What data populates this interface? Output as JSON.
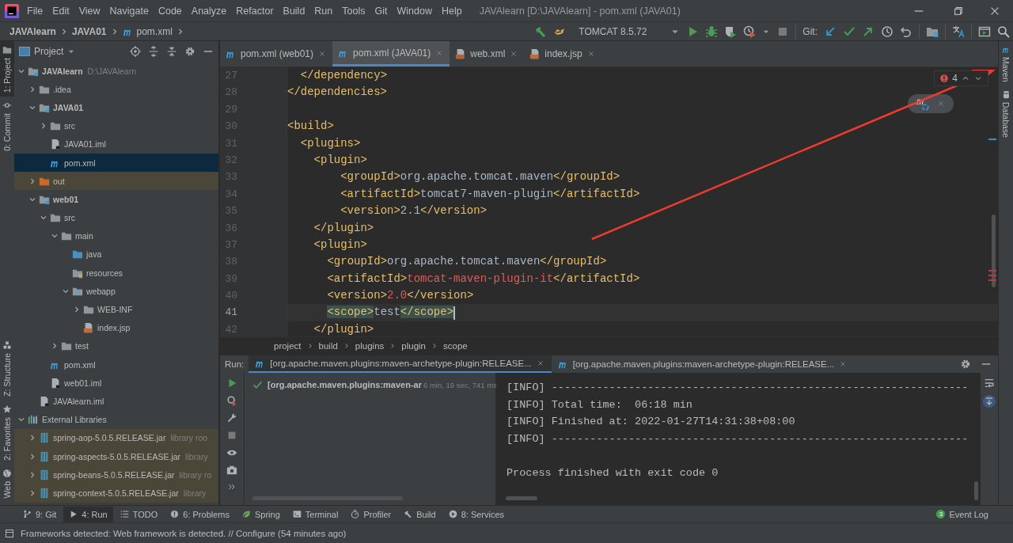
{
  "window": {
    "title": "JAVAlearn [D:\\JAVAlearn] - pom.xml (JAVA01)"
  },
  "menu": [
    "File",
    "Edit",
    "View",
    "Navigate",
    "Code",
    "Analyze",
    "Refactor",
    "Build",
    "Run",
    "Tools",
    "Git",
    "Window",
    "Help"
  ],
  "breadcrumb": [
    {
      "label": "JAVAlearn",
      "kind": "project"
    },
    {
      "label": "JAVA01",
      "kind": "project"
    },
    {
      "label": "pom.xml",
      "kind": "maven"
    }
  ],
  "toolbar": {
    "run_config": "TOMCAT 8.5.72",
    "vcs_label": "Git:"
  },
  "left_strip_top": [
    {
      "label": "1: Project",
      "kind": "project",
      "selected": true
    },
    {
      "label": "0: Commit",
      "kind": "commit",
      "selected": false
    }
  ],
  "left_strip_bottom": [
    {
      "label": "Z: Structure",
      "kind": "structure",
      "selected": false
    },
    {
      "label": "2: Favorites",
      "kind": "favorites",
      "selected": false
    },
    {
      "label": "Web",
      "kind": "web",
      "selected": false
    }
  ],
  "right_strip": [
    {
      "label": "Maven",
      "kind": "maven"
    },
    {
      "label": "Database",
      "kind": "database"
    }
  ],
  "project_panel": {
    "title": "Project",
    "tree": [
      {
        "label": "JAVAlearn",
        "hint": "D:\\JAVAlearn",
        "kind": "module",
        "expanded": true,
        "selected": false,
        "highlighted": false,
        "children": [
          {
            "label": ".idea",
            "kind": "folder",
            "expanded": false,
            "selected": false,
            "highlighted": false
          },
          {
            "label": "JAVA01",
            "kind": "module",
            "expanded": true,
            "selected": false,
            "highlighted": false,
            "children": [
              {
                "label": "src",
                "kind": "folder",
                "expanded": false,
                "selected": false,
                "highlighted": false
              },
              {
                "label": "JAVA01.iml",
                "kind": "iml",
                "selected": false,
                "highlighted": false
              },
              {
                "label": "pom.xml",
                "kind": "maven",
                "selected": true,
                "highlighted": false
              }
            ]
          },
          {
            "label": "out",
            "kind": "excluded",
            "expanded": false,
            "selected": false,
            "highlighted": true
          },
          {
            "label": "web01",
            "kind": "module",
            "expanded": true,
            "selected": false,
            "highlighted": false,
            "children": [
              {
                "label": "src",
                "kind": "folder",
                "expanded": true,
                "selected": false,
                "highlighted": false,
                "children": [
                  {
                    "label": "main",
                    "kind": "folder",
                    "expanded": true,
                    "selected": false,
                    "highlighted": false,
                    "children": [
                      {
                        "label": "java",
                        "kind": "source",
                        "selected": false,
                        "highlighted": false
                      },
                      {
                        "label": "resources",
                        "kind": "resources",
                        "selected": false,
                        "highlighted": false
                      },
                      {
                        "label": "webapp",
                        "kind": "web",
                        "expanded": true,
                        "selected": false,
                        "highlighted": false,
                        "children": [
                          {
                            "label": "WEB-INF",
                            "kind": "folder",
                            "expanded": false,
                            "selected": false,
                            "highlighted": false
                          },
                          {
                            "label": "index.jsp",
                            "kind": "jsp",
                            "selected": false,
                            "highlighted": false
                          }
                        ]
                      }
                    ]
                  },
                  {
                    "label": "test",
                    "kind": "folder",
                    "expanded": false,
                    "selected": false,
                    "highlighted": false
                  }
                ]
              },
              {
                "label": "pom.xml",
                "kind": "maven",
                "selected": false,
                "highlighted": false
              },
              {
                "label": "web01.iml",
                "kind": "iml",
                "selected": false,
                "highlighted": false
              }
            ]
          },
          {
            "label": "JAVAlearn.iml",
            "kind": "iml",
            "selected": false,
            "highlighted": false
          }
        ]
      },
      {
        "label": "External Libraries",
        "kind": "libraries",
        "expanded": true,
        "selected": false,
        "highlighted": false,
        "children": [
          {
            "label": "spring-aop-5.0.5.RELEASE.jar",
            "hint": "library roo",
            "kind": "jar",
            "expanded": false,
            "selected": false,
            "highlighted": true
          },
          {
            "label": "spring-aspects-5.0.5.RELEASE.jar",
            "hint": "library",
            "kind": "jar",
            "expanded": false,
            "selected": false,
            "highlighted": true
          },
          {
            "label": "spring-beans-5.0.5.RELEASE.jar",
            "hint": "library ro",
            "kind": "jar",
            "expanded": false,
            "selected": false,
            "highlighted": true
          },
          {
            "label": "spring-context-5.0.5.RELEASE.jar",
            "hint": "library",
            "kind": "jar",
            "expanded": false,
            "selected": false,
            "highlighted": true
          }
        ]
      }
    ]
  },
  "editor": {
    "tabs": [
      {
        "label": "pom.xml (web01)",
        "kind": "maven",
        "selected": false
      },
      {
        "label": "pom.xml (JAVA01)",
        "kind": "maven",
        "selected": true
      },
      {
        "label": "web.xml",
        "kind": "xml",
        "selected": false
      },
      {
        "label": "index.jsp",
        "kind": "jsp",
        "selected": false
      }
    ],
    "problems": "4",
    "lines": [
      {
        "number": "27",
        "current": false,
        "tokens": [
          {
            "text": "  </dependency>",
            "kind": "tag"
          }
        ]
      },
      {
        "number": "28",
        "current": false,
        "tokens": [
          {
            "text": "</dependencies>",
            "kind": "tag"
          }
        ]
      },
      {
        "number": "29",
        "current": false
      },
      {
        "number": "30",
        "current": false,
        "tokens": [
          {
            "text": "<build>",
            "kind": "tag"
          }
        ]
      },
      {
        "number": "31",
        "current": false,
        "tokens": [
          {
            "text": "  <plugins>",
            "kind": "tag"
          }
        ]
      },
      {
        "number": "32",
        "current": false,
        "tokens": [
          {
            "text": "    <plugin>",
            "kind": "tag"
          }
        ]
      },
      {
        "number": "33",
        "current": false,
        "tokens": [
          {
            "text": "        <groupId>",
            "kind": "tag"
          },
          {
            "text": "org.apache.tomcat.maven",
            "kind": "text"
          },
          {
            "text": "</groupId>",
            "kind": "tag"
          }
        ]
      },
      {
        "number": "34",
        "current": false,
        "tokens": [
          {
            "text": "        <artifactId>",
            "kind": "tag"
          },
          {
            "text": "tomcat7-maven-plugin",
            "kind": "text"
          },
          {
            "text": "</artifactId>",
            "kind": "tag"
          }
        ]
      },
      {
        "number": "35",
        "current": false,
        "tokens": [
          {
            "text": "        <version>",
            "kind": "tag"
          },
          {
            "text": "2.1",
            "kind": "text"
          },
          {
            "text": "</version>",
            "kind": "tag"
          }
        ]
      },
      {
        "number": "36",
        "current": false,
        "tokens": [
          {
            "text": "    </plugin>",
            "kind": "tag"
          }
        ]
      },
      {
        "number": "37",
        "current": false,
        "tokens": [
          {
            "text": "    <plugin>",
            "kind": "tag"
          }
        ]
      },
      {
        "number": "38",
        "current": false,
        "tokens": [
          {
            "text": "      <groupId>",
            "kind": "tag"
          },
          {
            "text": "org.apache.tomcat.maven",
            "kind": "text"
          },
          {
            "text": "</groupId>",
            "kind": "tag"
          }
        ]
      },
      {
        "number": "39",
        "current": false,
        "tokens": [
          {
            "text": "      <artifactId>",
            "kind": "tag"
          },
          {
            "text": "tomcat-maven-plugin-it",
            "kind": "error"
          },
          {
            "text": "</artifactId>",
            "kind": "tag"
          }
        ]
      },
      {
        "number": "40",
        "current": false,
        "tokens": [
          {
            "text": "      <version>",
            "kind": "tag"
          },
          {
            "text": "2.0",
            "kind": "error"
          },
          {
            "text": "</version>",
            "kind": "tag"
          }
        ]
      },
      {
        "number": "41",
        "current": true,
        "tokens": [
          {
            "text": "      <scope>",
            "kind": "match"
          },
          {
            "text": "test",
            "kind": "text"
          },
          {
            "text": "</scope>",
            "kind": "match"
          }
        ]
      },
      {
        "number": "42",
        "current": false,
        "tokens": [
          {
            "text": "    </plugin>",
            "kind": "tag"
          }
        ]
      }
    ],
    "breadcrumb": [
      "project",
      "build",
      "plugins",
      "plugin",
      "scope"
    ]
  },
  "run_panel": {
    "label": "Run:",
    "tabs": [
      {
        "label": "[org.apache.maven.plugins:maven-archetype-plugin:RELEASE...",
        "selected": true
      },
      {
        "label": "[org.apache.maven.plugins:maven-archetype-plugin:RELEASE...",
        "selected": false
      }
    ],
    "tree": [
      {
        "label": "[org.apache.maven.plugins:maven-ar",
        "time": "6 min, 19 sec, 741 ms",
        "passed": true
      }
    ],
    "console": [
      {
        "text": "[INFO] -----------------------------------------------------------------",
        "kind": "log"
      },
      {
        "text": "[INFO] Total time:  06:18 min",
        "kind": "log"
      },
      {
        "text": "[INFO] Finished at: 2022-01-27T14:31:38+08:00",
        "kind": "log"
      },
      {
        "text": "[INFO] -----------------------------------------------------------------",
        "kind": "log"
      },
      {
        "text": "Process finished with exit code 0",
        "kind": "result"
      }
    ]
  },
  "bottom_tools": [
    {
      "label": "9: Git",
      "kind": "git",
      "selected": false
    },
    {
      "label": "4: Run",
      "kind": "run",
      "selected": true
    },
    {
      "label": "TODO",
      "kind": "todo",
      "selected": false
    },
    {
      "label": "6: Problems",
      "kind": "problems",
      "selected": false
    },
    {
      "label": "Spring",
      "kind": "spring",
      "selected": false
    },
    {
      "label": "Terminal",
      "kind": "terminal",
      "selected": false
    },
    {
      "label": "Profiler",
      "kind": "profiler",
      "selected": false
    },
    {
      "label": "Build",
      "kind": "build",
      "selected": false
    },
    {
      "label": "8: Services",
      "kind": "services",
      "selected": false
    }
  ],
  "event_log": {
    "label": "Event Log",
    "count": "3"
  },
  "status_bar": {
    "message": "Frameworks detected: Web framework is detected. // Configure (54 minutes ago)"
  }
}
